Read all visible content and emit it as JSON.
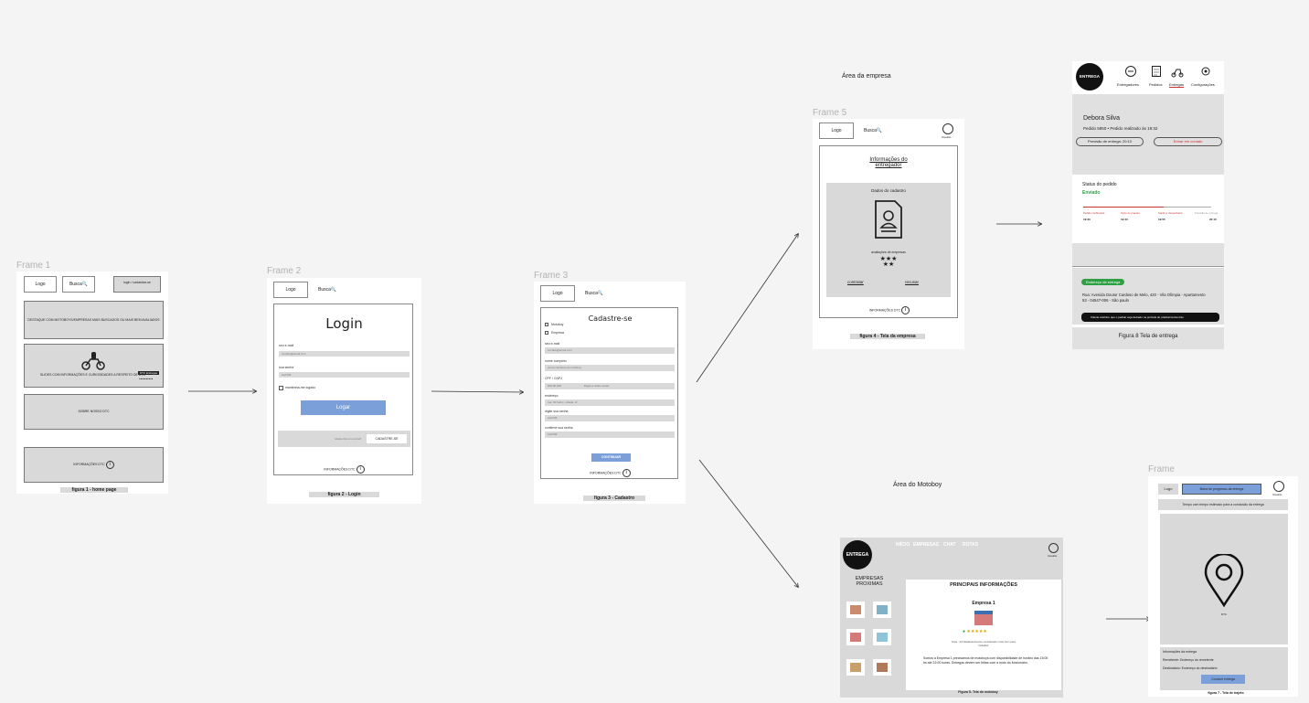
{
  "section_titles": {
    "empresa": "Área da empresa",
    "motoboy": "Área do Motoboy"
  },
  "frame1": {
    "label": "Frame 1",
    "logo": "Logo",
    "busca": "Busca🔍",
    "login_cadastro": "login / cadastrar-se",
    "banner_text": "DESTAQUE COM MOTOBOYS/EMPRESAS MAIS BUSCADOS OU MAIS BEM AVALIADOS",
    "slides_text": "SLIDES COM INFORMAÇÕES E CURIOSIDADES A RESPEITO DE DTC",
    "slides_badge": "DTC Entregas",
    "slides_dots": "●●●●●●●●●●",
    "sobre": "SOBRE NOSSO DTC",
    "info": "INFORMAÇÕES DTC",
    "caption": "figura 1 - home page"
  },
  "frame2": {
    "label": "Frame 2",
    "logo": "Logo",
    "busca": "Busca🔍",
    "title": "Login",
    "email_label": "seu e-mail",
    "email_ph": "contato@email.com",
    "senha_label": "sua senha",
    "senha_ph": "Ae07##",
    "lembrar": "mantenha-me logado",
    "logar": "Logar",
    "nao_tem": "Ainda não tem conta?",
    "cadastrar": "CADASTRE-SE",
    "info": "INFORMAÇÕES DTC",
    "caption": "figura 2 - Login"
  },
  "frame3": {
    "label": "Frame 3",
    "logo": "Logo",
    "busca": "Busca🔍",
    "title": "Cadastre-se",
    "opt1": "Motoboy",
    "opt2": "Empresa",
    "email_label": "seu e-mail",
    "email_ph": "contato@email.com",
    "nome_label": "nome completo",
    "nome_ph": "nome completo do motoboy",
    "cpf_label": "CPF / CNPJ",
    "cpf_ph": "000.00.000",
    "social_ph": "Digite a razão social",
    "end_label": "endereço",
    "end_ph": "rua, 00 bairro, cidade, sf",
    "senha_label": "digite sua senha",
    "senha_ph": "Ae07##",
    "conf_label": "confirme sua senha",
    "conf_ph": "Ae07##",
    "continuar": "CONTINUAR",
    "info": "INFORMAÇÕES DTC",
    "caption": "figura 3 - Cadastro"
  },
  "frame5": {
    "label": "Frame 5",
    "logo": "Logo",
    "busca": "Busca🔍",
    "usuario": "Usuário",
    "title": "Informações do entregador",
    "dados": "Dados do cadastro",
    "avaliacoes": "avaliações de empresas",
    "stars_top": "★★★",
    "stars_bottom": "★★",
    "contratar": "contratar",
    "recusar": "recusar",
    "info": "INFORMAÇÕES DTC",
    "caption": "figura 4 - Tela da empresa"
  },
  "frame8": {
    "brand": "ENTREGA",
    "nav": [
      "Entregadores",
      "Pedidos",
      "Entregas",
      "Configurações"
    ],
    "cliente": "Debora Silva",
    "pedido": "Pedido 5850 • Pedido realizado às 19:32",
    "previsao": "Previsão de entrega: 20:10",
    "contato": "Entrar em contato",
    "status_label": "Status do pedido",
    "status_value": "Enviado",
    "steps": [
      {
        "label": "Pedido confirmado",
        "time": "19:33"
      },
      {
        "label": "Início do preparo",
        "time": "19:43"
      },
      {
        "label": "Saída p/ despachado",
        "time": "19:55"
      },
      {
        "label": "Previsão de entrega",
        "time": "20:10"
      }
    ],
    "endereco_badge": "Endereço de entrega",
    "endereco": "Rua: Avenida Doutor Cardoso de Melo, 420 - Vila Olímpia - Apartamento 53 - 04547-006 - São paulo",
    "aviso": "Cliente solicitou que o pedido seja deixado na portaria do prédio/condomínio",
    "caption": "Figura 8 Tela de entrega"
  },
  "frame6": {
    "brand": "ENTREGA",
    "nav": [
      "INÍCIO",
      "EMPRESAS",
      "CHAT",
      "ROTAS"
    ],
    "usuario": "Usuário",
    "empresas": "EMPRESAS PROXIMAS",
    "principais": "PRINCIPAIS INFORMAÇÕES",
    "empresa": "Empresa 1",
    "nota": "Nota : 4,5 Estabelecimento considerado muito bom para trabalhar",
    "descricao": "Somos a Empresa 1 precisamos de motoboys com disponibilidade de horário das 15:00 hs até 22:00 horas. Entregas devem ser feitas com a moto do funcionário.",
    "caption": "Figura 5- Tela do motoboy"
  },
  "frame7": {
    "label": "Frame",
    "logo": "Logo",
    "barra": "Barra de progresso da entrega",
    "usuario": "Usuário",
    "tempo": "Tempo com tempo estimado para a conclusão da entrega",
    "dtc": "DTC",
    "info1": "Informações da entrega",
    "info2": "Remetente: Endereço do remetente",
    "info3": "Destinatário: Endereço do destinatário",
    "concluir": "Concluir entrega",
    "caption": "figura 7 - Tela de trajeto"
  }
}
